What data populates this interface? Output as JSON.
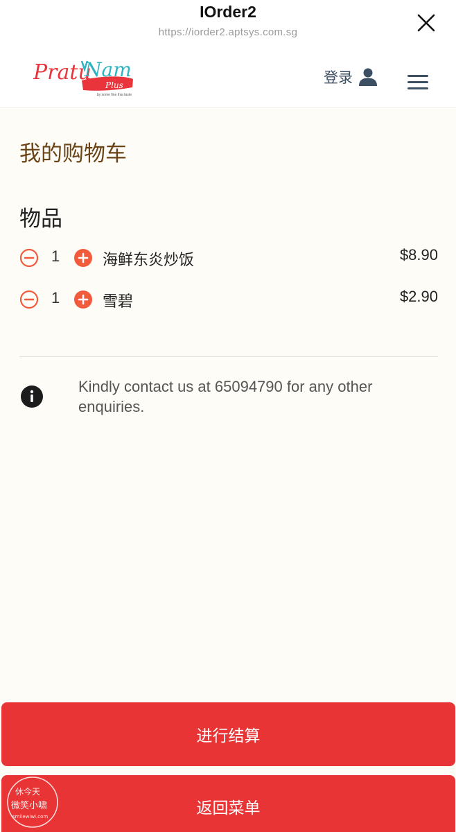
{
  "browser": {
    "title": "IOrder2",
    "url": "https://iorder2.aptsys.com.sg"
  },
  "header": {
    "logo_text": "PratuNam",
    "logo_sub": "Plus",
    "login_label": "登录"
  },
  "cart": {
    "page_title": "我的购物车",
    "section_title": "物品",
    "items": [
      {
        "qty": "1",
        "name": "海鲜东炎炒饭",
        "price": "$8.90"
      },
      {
        "qty": "1",
        "name": "雪碧",
        "price": "$2.90"
      }
    ]
  },
  "info": {
    "text": "Kindly contact us at 65094790 for any other enquiries."
  },
  "buttons": {
    "checkout": "进行结算",
    "back_to_menu": "返回菜单"
  },
  "watermark": {
    "line1": "休今天",
    "line2": "微笑小啸",
    "line3": "smilewiwi.com"
  },
  "colors": {
    "accent_red": "#e83434",
    "qty_orange": "#f25a3c",
    "title_brown": "#6a4417",
    "nav_slate": "#3d4f63"
  },
  "icons": {
    "close": "close-icon",
    "user": "user-icon",
    "menu": "hamburger-icon",
    "minus": "minus-circle-icon",
    "plus": "plus-circle-icon",
    "info": "info-icon"
  }
}
